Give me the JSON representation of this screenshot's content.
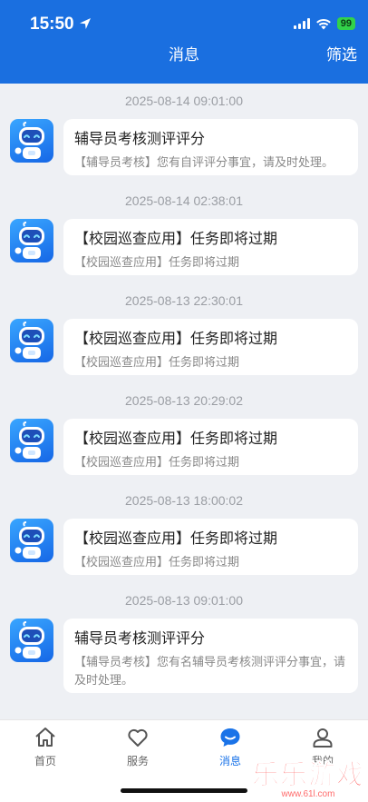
{
  "status_bar": {
    "time": "15:50",
    "battery": "99"
  },
  "nav": {
    "title": "消息",
    "filter": "筛选"
  },
  "messages": [
    {
      "time": "2025-08-14 09:01:00",
      "title": "辅导员考核测评评分",
      "body": "【辅导员考核】您有自评评分事宜，请及时处理。"
    },
    {
      "time": "2025-08-14 02:38:01",
      "title": "【校园巡查应用】任务即将过期",
      "body": "【校园巡查应用】任务即将过期"
    },
    {
      "time": "2025-08-13 22:30:01",
      "title": "【校园巡查应用】任务即将过期",
      "body": "【校园巡查应用】任务即将过期"
    },
    {
      "time": "2025-08-13 20:29:02",
      "title": "【校园巡查应用】任务即将过期",
      "body": "【校园巡查应用】任务即将过期"
    },
    {
      "time": "2025-08-13 18:00:02",
      "title": "【校园巡查应用】任务即将过期",
      "body": "【校园巡查应用】任务即将过期"
    },
    {
      "time": "2025-08-13 09:01:00",
      "title": "辅导员考核测评评分",
      "body": "【辅导员考核】您有名辅导员考核测评评分事宜，请及时处理。"
    }
  ],
  "tabs": [
    {
      "label": "首页",
      "icon": "home-icon",
      "active": false
    },
    {
      "label": "服务",
      "icon": "heart-icon",
      "active": false
    },
    {
      "label": "消息",
      "icon": "chat-bubble-icon",
      "active": true
    },
    {
      "label": "我的",
      "icon": "user-icon",
      "active": false
    }
  ],
  "watermark": {
    "logo": "乐乐游戏",
    "url": "www.61l.com"
  },
  "colors": {
    "brand": "#1a6fe0",
    "tab_active": "#1a73e8",
    "background": "#eef0f4"
  }
}
